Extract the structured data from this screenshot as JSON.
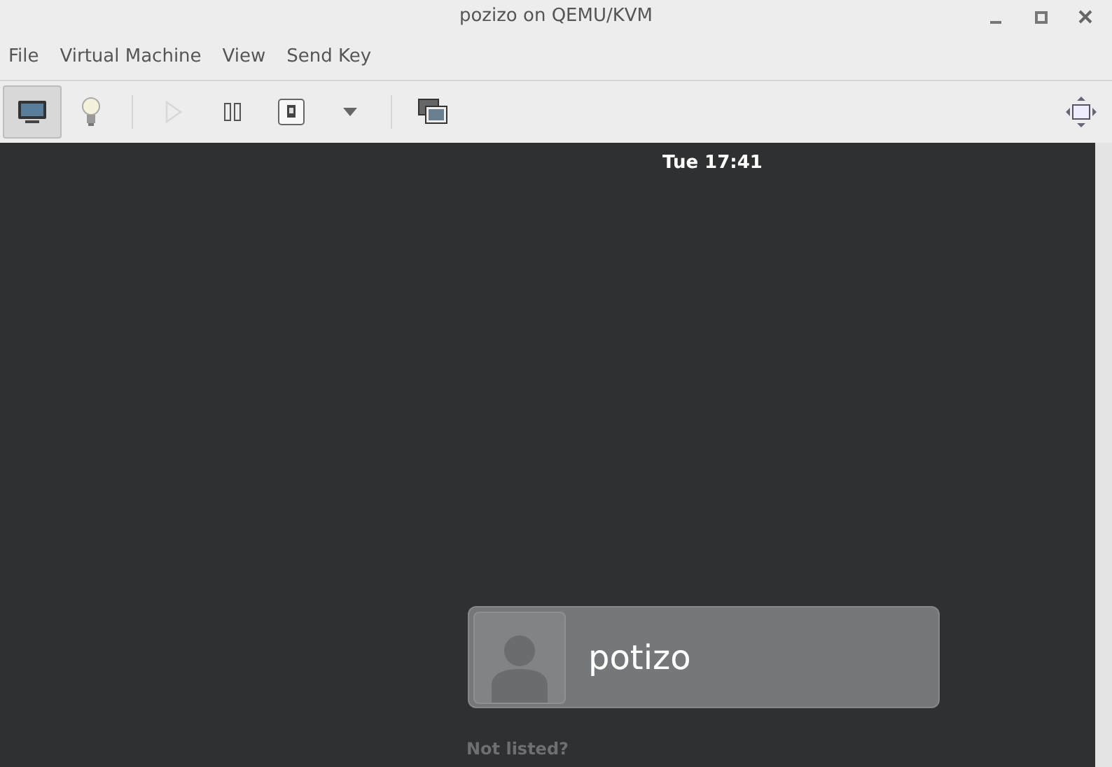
{
  "window": {
    "title": "pozizo on QEMU/KVM"
  },
  "menu": [
    "File",
    "Virtual Machine",
    "View",
    "Send Key"
  ],
  "toolbar": [
    {
      "kind": "console",
      "selected": true,
      "disabled": false
    },
    {
      "kind": "details",
      "selected": false,
      "disabled": false
    },
    {
      "kind": "separator"
    },
    {
      "kind": "run",
      "selected": false,
      "disabled": true
    },
    {
      "kind": "pause",
      "selected": false,
      "disabled": false
    },
    {
      "kind": "power",
      "selected": false,
      "disabled": false
    },
    {
      "kind": "dropdown",
      "selected": false,
      "disabled": false
    },
    {
      "kind": "separator"
    },
    {
      "kind": "snapshots",
      "selected": false,
      "disabled": false
    }
  ],
  "guest": {
    "clock": "Tue 17:41",
    "users": [
      {
        "name": "potizo",
        "selected": true
      }
    ],
    "not_listed": "Not listed?"
  }
}
